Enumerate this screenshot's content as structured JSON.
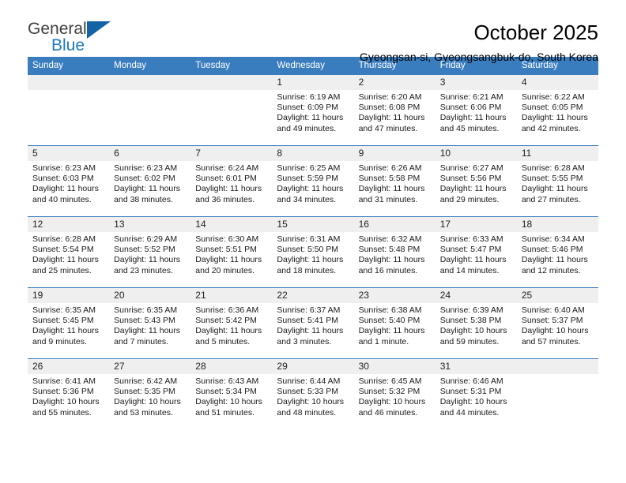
{
  "brand": {
    "name_part1": "General",
    "name_part2": "Blue",
    "accent_color": "#1b79c4"
  },
  "header": {
    "title": "October 2025",
    "location": "Gyeongsan-si, Gyeongsangbuk-do, South Korea"
  },
  "calendar": {
    "header_background": "#3a7dbf",
    "daynum_background": "#efefef",
    "weekday_names": [
      "Sunday",
      "Monday",
      "Tuesday",
      "Wednesday",
      "Thursday",
      "Friday",
      "Saturday"
    ],
    "weeks": [
      [
        {
          "day": "",
          "empty": true
        },
        {
          "day": "",
          "empty": true
        },
        {
          "day": "",
          "empty": true
        },
        {
          "day": "1",
          "sunrise": "Sunrise: 6:19 AM",
          "sunset": "Sunset: 6:09 PM",
          "daylight_line1": "Daylight: 11 hours",
          "daylight_line2": "and 49 minutes."
        },
        {
          "day": "2",
          "sunrise": "Sunrise: 6:20 AM",
          "sunset": "Sunset: 6:08 PM",
          "daylight_line1": "Daylight: 11 hours",
          "daylight_line2": "and 47 minutes."
        },
        {
          "day": "3",
          "sunrise": "Sunrise: 6:21 AM",
          "sunset": "Sunset: 6:06 PM",
          "daylight_line1": "Daylight: 11 hours",
          "daylight_line2": "and 45 minutes."
        },
        {
          "day": "4",
          "sunrise": "Sunrise: 6:22 AM",
          "sunset": "Sunset: 6:05 PM",
          "daylight_line1": "Daylight: 11 hours",
          "daylight_line2": "and 42 minutes."
        }
      ],
      [
        {
          "day": "5",
          "sunrise": "Sunrise: 6:23 AM",
          "sunset": "Sunset: 6:03 PM",
          "daylight_line1": "Daylight: 11 hours",
          "daylight_line2": "and 40 minutes."
        },
        {
          "day": "6",
          "sunrise": "Sunrise: 6:23 AM",
          "sunset": "Sunset: 6:02 PM",
          "daylight_line1": "Daylight: 11 hours",
          "daylight_line2": "and 38 minutes."
        },
        {
          "day": "7",
          "sunrise": "Sunrise: 6:24 AM",
          "sunset": "Sunset: 6:01 PM",
          "daylight_line1": "Daylight: 11 hours",
          "daylight_line2": "and 36 minutes."
        },
        {
          "day": "8",
          "sunrise": "Sunrise: 6:25 AM",
          "sunset": "Sunset: 5:59 PM",
          "daylight_line1": "Daylight: 11 hours",
          "daylight_line2": "and 34 minutes."
        },
        {
          "day": "9",
          "sunrise": "Sunrise: 6:26 AM",
          "sunset": "Sunset: 5:58 PM",
          "daylight_line1": "Daylight: 11 hours",
          "daylight_line2": "and 31 minutes."
        },
        {
          "day": "10",
          "sunrise": "Sunrise: 6:27 AM",
          "sunset": "Sunset: 5:56 PM",
          "daylight_line1": "Daylight: 11 hours",
          "daylight_line2": "and 29 minutes."
        },
        {
          "day": "11",
          "sunrise": "Sunrise: 6:28 AM",
          "sunset": "Sunset: 5:55 PM",
          "daylight_line1": "Daylight: 11 hours",
          "daylight_line2": "and 27 minutes."
        }
      ],
      [
        {
          "day": "12",
          "sunrise": "Sunrise: 6:28 AM",
          "sunset": "Sunset: 5:54 PM",
          "daylight_line1": "Daylight: 11 hours",
          "daylight_line2": "and 25 minutes."
        },
        {
          "day": "13",
          "sunrise": "Sunrise: 6:29 AM",
          "sunset": "Sunset: 5:52 PM",
          "daylight_line1": "Daylight: 11 hours",
          "daylight_line2": "and 23 minutes."
        },
        {
          "day": "14",
          "sunrise": "Sunrise: 6:30 AM",
          "sunset": "Sunset: 5:51 PM",
          "daylight_line1": "Daylight: 11 hours",
          "daylight_line2": "and 20 minutes."
        },
        {
          "day": "15",
          "sunrise": "Sunrise: 6:31 AM",
          "sunset": "Sunset: 5:50 PM",
          "daylight_line1": "Daylight: 11 hours",
          "daylight_line2": "and 18 minutes."
        },
        {
          "day": "16",
          "sunrise": "Sunrise: 6:32 AM",
          "sunset": "Sunset: 5:48 PM",
          "daylight_line1": "Daylight: 11 hours",
          "daylight_line2": "and 16 minutes."
        },
        {
          "day": "17",
          "sunrise": "Sunrise: 6:33 AM",
          "sunset": "Sunset: 5:47 PM",
          "daylight_line1": "Daylight: 11 hours",
          "daylight_line2": "and 14 minutes."
        },
        {
          "day": "18",
          "sunrise": "Sunrise: 6:34 AM",
          "sunset": "Sunset: 5:46 PM",
          "daylight_line1": "Daylight: 11 hours",
          "daylight_line2": "and 12 minutes."
        }
      ],
      [
        {
          "day": "19",
          "sunrise": "Sunrise: 6:35 AM",
          "sunset": "Sunset: 5:45 PM",
          "daylight_line1": "Daylight: 11 hours",
          "daylight_line2": "and 9 minutes."
        },
        {
          "day": "20",
          "sunrise": "Sunrise: 6:35 AM",
          "sunset": "Sunset: 5:43 PM",
          "daylight_line1": "Daylight: 11 hours",
          "daylight_line2": "and 7 minutes."
        },
        {
          "day": "21",
          "sunrise": "Sunrise: 6:36 AM",
          "sunset": "Sunset: 5:42 PM",
          "daylight_line1": "Daylight: 11 hours",
          "daylight_line2": "and 5 minutes."
        },
        {
          "day": "22",
          "sunrise": "Sunrise: 6:37 AM",
          "sunset": "Sunset: 5:41 PM",
          "daylight_line1": "Daylight: 11 hours",
          "daylight_line2": "and 3 minutes."
        },
        {
          "day": "23",
          "sunrise": "Sunrise: 6:38 AM",
          "sunset": "Sunset: 5:40 PM",
          "daylight_line1": "Daylight: 11 hours",
          "daylight_line2": "and 1 minute."
        },
        {
          "day": "24",
          "sunrise": "Sunrise: 6:39 AM",
          "sunset": "Sunset: 5:38 PM",
          "daylight_line1": "Daylight: 10 hours",
          "daylight_line2": "and 59 minutes."
        },
        {
          "day": "25",
          "sunrise": "Sunrise: 6:40 AM",
          "sunset": "Sunset: 5:37 PM",
          "daylight_line1": "Daylight: 10 hours",
          "daylight_line2": "and 57 minutes."
        }
      ],
      [
        {
          "day": "26",
          "sunrise": "Sunrise: 6:41 AM",
          "sunset": "Sunset: 5:36 PM",
          "daylight_line1": "Daylight: 10 hours",
          "daylight_line2": "and 55 minutes."
        },
        {
          "day": "27",
          "sunrise": "Sunrise: 6:42 AM",
          "sunset": "Sunset: 5:35 PM",
          "daylight_line1": "Daylight: 10 hours",
          "daylight_line2": "and 53 minutes."
        },
        {
          "day": "28",
          "sunrise": "Sunrise: 6:43 AM",
          "sunset": "Sunset: 5:34 PM",
          "daylight_line1": "Daylight: 10 hours",
          "daylight_line2": "and 51 minutes."
        },
        {
          "day": "29",
          "sunrise": "Sunrise: 6:44 AM",
          "sunset": "Sunset: 5:33 PM",
          "daylight_line1": "Daylight: 10 hours",
          "daylight_line2": "and 48 minutes."
        },
        {
          "day": "30",
          "sunrise": "Sunrise: 6:45 AM",
          "sunset": "Sunset: 5:32 PM",
          "daylight_line1": "Daylight: 10 hours",
          "daylight_line2": "and 46 minutes."
        },
        {
          "day": "31",
          "sunrise": "Sunrise: 6:46 AM",
          "sunset": "Sunset: 5:31 PM",
          "daylight_line1": "Daylight: 10 hours",
          "daylight_line2": "and 44 minutes."
        },
        {
          "day": "",
          "empty": true
        }
      ]
    ]
  }
}
